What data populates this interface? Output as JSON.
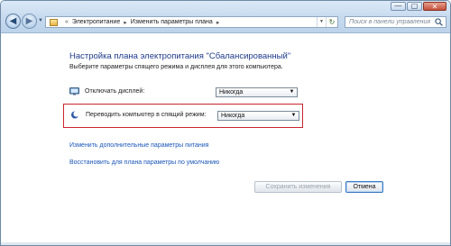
{
  "window": {
    "caption_buttons": {
      "minimize": "—",
      "maximize": "▢",
      "close": "✕"
    }
  },
  "address_bar": {
    "crumbs": [
      "Электропитание",
      "Изменить параметры плана"
    ],
    "separator": "▸",
    "leading_separator": "«"
  },
  "search": {
    "placeholder": "Поиск в панели управления"
  },
  "content": {
    "title": "Настройка плана электропитания \"Сбалансированный\"",
    "subtitle": "Выберите параметры спящего режима и дисплея для этого компьютера.",
    "settings": [
      {
        "label": "Отключать дисплей:",
        "value": "Никогда",
        "icon": "monitor-icon"
      },
      {
        "label": "Переводить компьютер в спящий режим:",
        "value": "Никогда",
        "icon": "moon-icon"
      }
    ],
    "links": [
      "Изменить дополнительные параметры питания",
      "Восстановить для плана параметры по умолчанию"
    ]
  },
  "buttons": {
    "save": "Сохранить изменения",
    "cancel": "Отмена"
  },
  "colors": {
    "title": "#1e3a8a",
    "link": "#1a56b8",
    "highlight": "#c9252f"
  }
}
